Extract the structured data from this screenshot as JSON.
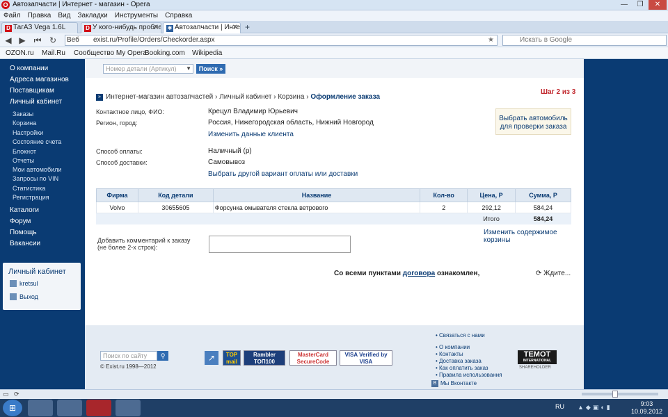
{
  "window": {
    "title": "Автозапчасти | Интернет - магазин - Opera"
  },
  "menu": [
    "Файл",
    "Правка",
    "Вид",
    "Закладки",
    "Инструменты",
    "Справка"
  ],
  "tabs": [
    {
      "label": "ТагАЗ Vega 1.6L"
    },
    {
      "label": "У кого-нибудь пробле..."
    },
    {
      "label": "Автозапчасти | Интер..."
    }
  ],
  "address": {
    "web_label": "Веб",
    "url": "exist.ru/Profile/Orders/Checkorder.aspx",
    "search_placeholder": "Искать в Google"
  },
  "bookmarks": [
    "OZON.ru",
    "Mail.Ru",
    "Сообщество My Opera",
    "Booking.com",
    "Wikipedia"
  ],
  "leftnav": {
    "main_top": [
      "О компании",
      "Адреса магазинов",
      "Поставщикам",
      "Личный кабинет"
    ],
    "sub": [
      "Заказы",
      "Корзина",
      "Настройки",
      "Состояние счета",
      "Блокнот",
      "Отчеты",
      "Мои автомобили",
      "Запросы по VIN",
      "Статистика",
      "Регистрация"
    ],
    "main_bottom": [
      "Каталоги",
      "Форум",
      "Помощь",
      "Вакансии"
    ],
    "cabinet_title": "Личный кабинет",
    "user": "kretsul",
    "logout": "Выход"
  },
  "search": {
    "placeholder": "Номер детали (Артикул)",
    "button": "Поиск »"
  },
  "breadcrumb": [
    "Интернет-магазин автозапчастей",
    "Личный кабинет",
    "Корзина"
  ],
  "breadcrumb_current": "Оформление заказа",
  "step": "Шаг 2 из 3",
  "client": {
    "contact_label": "Контактное лицо, ФИО:",
    "contact_value": "Крецул Владимир Юрьевич",
    "region_label": "Регион, город:",
    "region_value": "Россия, Нижегородская область, Нижний Новгород",
    "change_link": "Изменить данные клиента"
  },
  "car_box": {
    "line1": "Выбрать автомобиль",
    "line2": "для проверки заказа"
  },
  "payment": {
    "pay_label": "Способ оплаты:",
    "pay_value": "Наличный (р)",
    "delivery_label": "Способ доставки:",
    "delivery_value": "Самовывоз",
    "change_link": "Выбрать другой вариант оплаты или доставки"
  },
  "table": {
    "headers": [
      "Фирма",
      "Код детали",
      "Название",
      "Кол-во",
      "Цена, Р",
      "Сумма, Р"
    ],
    "rows": [
      [
        "Volvo",
        "30655605",
        "Форсунка омывателя стекла ветрового",
        "2",
        "292,12",
        "584,24"
      ]
    ],
    "total_label": "Итого",
    "total_value": "584,24"
  },
  "edit_cart": "Изменить содержимое корзины",
  "comment": {
    "line1": "Добавить комментарий к заказу",
    "line2": "(не более 2-х строк):"
  },
  "agree": {
    "prefix": "Со всеми пунктами",
    "link": "договора",
    "suffix": "ознакомлен,",
    "waiting": "Ждите..."
  },
  "footer": {
    "search_placeholder": "Поиск по сайту",
    "copyright": "© Exist.ru 1998—2012",
    "badges": [
      "TOP mail",
      "Rambler ТОП100",
      "MasterCard SecureCode",
      "VISA Verified by VISA"
    ],
    "contact_link": "Связаться с нами",
    "links": [
      "О компании",
      "Контакты",
      "Доставка заказа",
      "Как оплатить заказ",
      "Правила использования"
    ],
    "vk": "Мы Вконтакте",
    "temot": "TEMOT",
    "temot_sub": "INTERNATIONAL",
    "temot_sh": "SHAREHOLDER"
  },
  "taskbar": {
    "lang": "RU",
    "time": "9:03",
    "date": "10.09.2012"
  }
}
